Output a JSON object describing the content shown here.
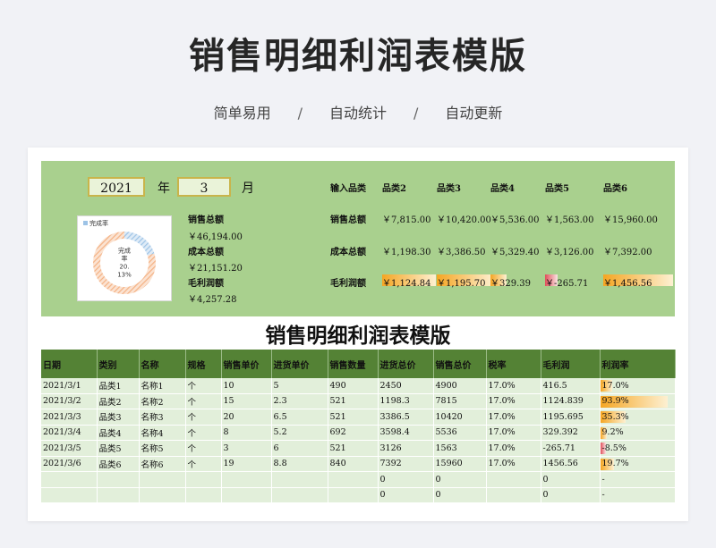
{
  "page": {
    "title": "销售明细利润表模版",
    "subtitle": [
      "简单易用",
      "自动统计",
      "自动更新"
    ],
    "separator": "/"
  },
  "dashboard": {
    "year": "2021",
    "year_label": "年",
    "month": "3",
    "month_label": "月",
    "donut": {
      "legend": "完成率",
      "center_text": "完成率,20.13%",
      "completion": 0.2013,
      "color_done": "#9dc3e6",
      "color_remaining": "#f4b183"
    },
    "stats": {
      "sales_label": "销售总额",
      "sales_value": "￥46,194.00",
      "cost_label": "成本总额",
      "cost_value": "￥21,151.20",
      "profit_label": "毛利润额",
      "profit_value": "￥4,257.28"
    },
    "category_table": {
      "row_labels": [
        "输入品类",
        "销售总额",
        "成本总额",
        "毛利润额"
      ],
      "categories": [
        "品类2",
        "品类3",
        "品类4",
        "品类5",
        "品类6"
      ],
      "sales": [
        "￥7,815.00",
        "￥10,420.00",
        "￥5,536.00",
        "￥1,563.00",
        "￥15,960.00"
      ],
      "cost": [
        "￥1,198.30",
        "￥3,386.50",
        "￥5,329.40",
        "￥3,126.00",
        "￥7,392.00"
      ],
      "profit": [
        "￥1,124.84",
        "￥1,195.70",
        "￥329.39",
        "￥-265.71",
        "￥1,456.56"
      ],
      "profit_values": [
        1124.84,
        1195.7,
        329.39,
        -265.71,
        1456.56
      ]
    }
  },
  "table": {
    "title": "销售明细利润表模版",
    "headers": [
      "日期",
      "类别",
      "名称",
      "规格",
      "销售单价",
      "进货单价",
      "销售数量",
      "进货总价",
      "销售总价",
      "税率",
      "毛利润",
      "利润率"
    ],
    "rows": [
      [
        "2021/3/1",
        "品类1",
        "名称1",
        "个",
        "10",
        "5",
        "490",
        "2450",
        "4900",
        "17.0%",
        "416.5",
        "17.0%"
      ],
      [
        "2021/3/2",
        "品类2",
        "名称2",
        "个",
        "15",
        "2.3",
        "521",
        "1198.3",
        "7815",
        "17.0%",
        "1124.839",
        "93.9%"
      ],
      [
        "2021/3/3",
        "品类3",
        "名称3",
        "个",
        "20",
        "6.5",
        "521",
        "3386.5",
        "10420",
        "17.0%",
        "1195.695",
        "35.3%"
      ],
      [
        "2021/3/4",
        "品类4",
        "名称4",
        "个",
        "8",
        "5.2",
        "692",
        "3598.4",
        "5536",
        "17.0%",
        "329.392",
        "9.2%"
      ],
      [
        "2021/3/5",
        "品类5",
        "名称5",
        "个",
        "3",
        "6",
        "521",
        "3126",
        "1563",
        "17.0%",
        "-265.71",
        "-8.5%"
      ],
      [
        "2021/3/6",
        "品类6",
        "名称6",
        "个",
        "19",
        "8.8",
        "840",
        "7392",
        "15960",
        "17.0%",
        "1456.56",
        "19.7%"
      ],
      [
        "",
        "",
        "",
        "",
        "",
        "",
        "",
        "0",
        "0",
        "",
        "0",
        "-"
      ],
      [
        "",
        "",
        "",
        "",
        "",
        "",
        "",
        "0",
        "0",
        "",
        "0",
        "-"
      ]
    ],
    "profit_rate_values": [
      0.17,
      0.939,
      0.353,
      0.092,
      -0.085,
      0.197,
      null,
      null
    ]
  }
}
